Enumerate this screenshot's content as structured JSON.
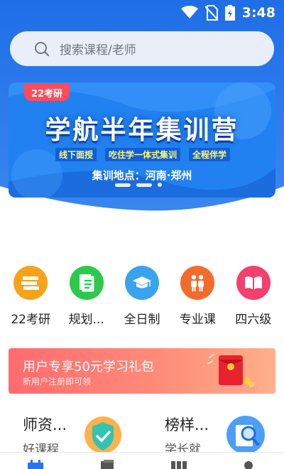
{
  "status_bar": {
    "time": "3:48"
  },
  "search": {
    "placeholder": "搜索课程/老师"
  },
  "banner": {
    "badge": "22考研",
    "title": "学航半年集训营",
    "subtitles": [
      "线下面授",
      "吃住学一体式集训",
      "全程伴学"
    ],
    "location": "集训地点：河南·郑州"
  },
  "categories": [
    {
      "label": "22考研",
      "color": "#f7a21b"
    },
    {
      "label": "规划...",
      "color": "#2ec84c"
    },
    {
      "label": "全日制",
      "color": "#3aa3ef"
    },
    {
      "label": "专业课",
      "color": "#f36b2c"
    },
    {
      "label": "四六级",
      "color": "#f4406e"
    }
  ],
  "promo": {
    "title": "用户专享50元学习礼包",
    "subtitle": "新用户注册即可领"
  },
  "features": [
    {
      "title": "师资...",
      "subtitle": "好课程"
    },
    {
      "title": "榜样...",
      "subtitle": "学长就"
    }
  ],
  "colors": {
    "primary": "#1e6fe8",
    "promo": "#ff6b6f"
  }
}
